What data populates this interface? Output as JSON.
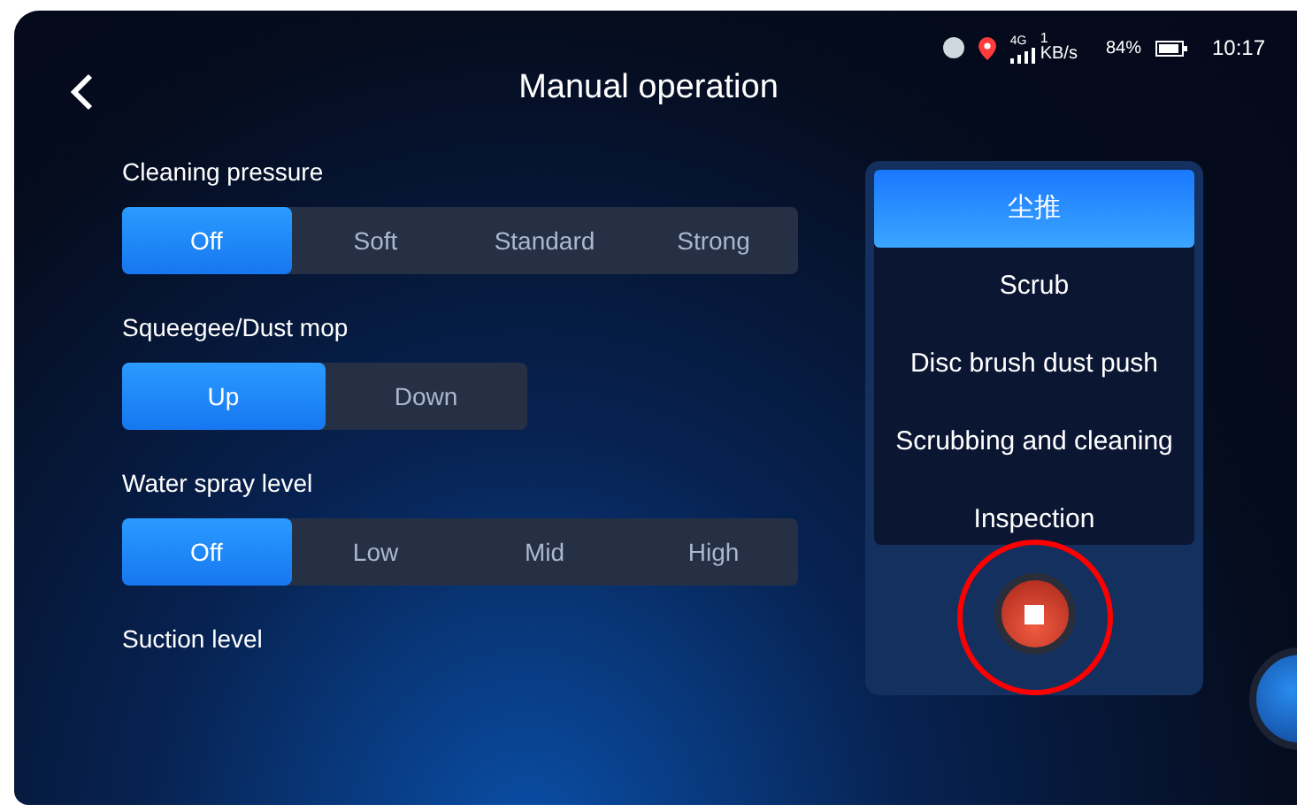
{
  "status_bar": {
    "signal_type": "4G",
    "speed_value": "1",
    "speed_unit": "KB/s",
    "battery": "84%",
    "time": "10:17"
  },
  "header": {
    "title": "Manual operation"
  },
  "settings": [
    {
      "label": "Cleaning pressure",
      "options": [
        {
          "label": "Off",
          "selected": true
        },
        {
          "label": "Soft",
          "selected": false
        },
        {
          "label": "Standard",
          "selected": false
        },
        {
          "label": "Strong",
          "selected": false
        }
      ]
    },
    {
      "label": "Squeegee/Dust mop",
      "options": [
        {
          "label": "Up",
          "selected": true
        },
        {
          "label": "Down",
          "selected": false
        }
      ]
    },
    {
      "label": "Water spray level",
      "options": [
        {
          "label": "Off",
          "selected": true
        },
        {
          "label": "Low",
          "selected": false
        },
        {
          "label": "Mid",
          "selected": false
        },
        {
          "label": "High",
          "selected": false
        }
      ]
    },
    {
      "label": "Suction level"
    }
  ],
  "modes": [
    {
      "label": "尘推",
      "selected": true
    },
    {
      "label": "Scrub",
      "selected": false
    },
    {
      "label": "Disc brush dust push",
      "selected": false
    },
    {
      "label": "Scrubbing and cleaning",
      "selected": false
    },
    {
      "label": "Inspection",
      "selected": false
    }
  ]
}
